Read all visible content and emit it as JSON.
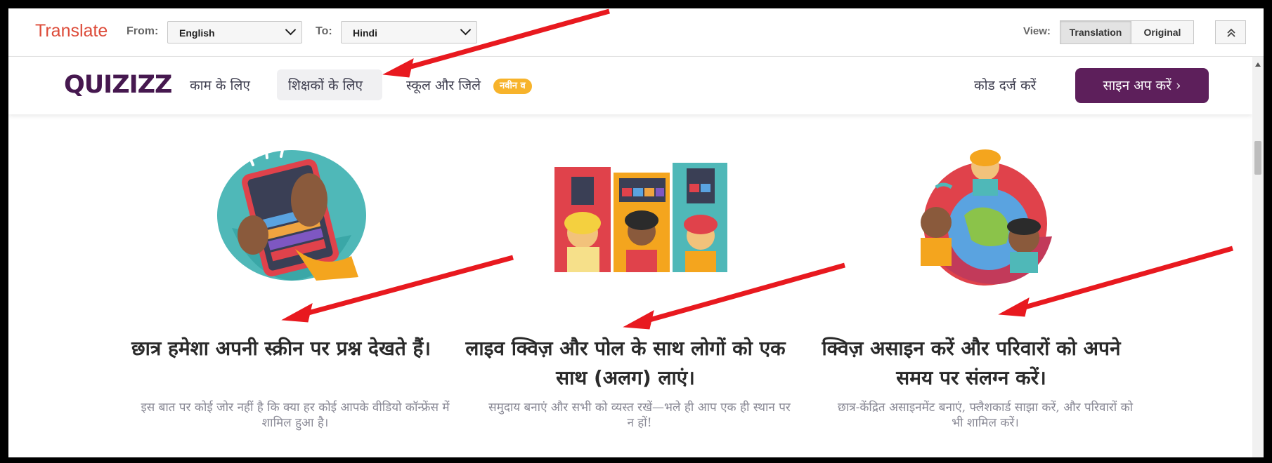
{
  "translate_bar": {
    "brand": "Translate",
    "from_label": "From:",
    "from_value": "English",
    "to_label": "To:",
    "to_value": "Hindi",
    "view_label": "View:",
    "view_translation": "Translation",
    "view_original": "Original"
  },
  "nav": {
    "logo": "QUIZIZZ",
    "items": [
      {
        "label": "काम के लिए"
      },
      {
        "label": "शिक्षकों के लिए"
      },
      {
        "label": "स्कूल और जिले"
      }
    ],
    "badge": "नवीन व",
    "code_link": "कोड दर्ज करें",
    "signup": "साइन अप करें ›"
  },
  "features": [
    {
      "title": "छात्र हमेशा अपनी स्क्रीन पर प्रश्न देखते हैं।",
      "desc": "इस बात पर कोई जोर नहीं है कि क्या हर कोई आपके वीडियो कॉन्फ्रेंस में शामिल हुआ है।"
    },
    {
      "title": "लाइव क्विज़ और पोल के साथ लोगों को एक साथ (अलग) लाएं।",
      "desc": "समुदाय बनाएं और सभी को व्यस्त रखें—भले ही आप एक ही स्थान पर न हों!"
    },
    {
      "title": "क्विज़ असाइन करें और परिवारों को अपने समय पर संलग्न करें।",
      "desc": "छात्र-केंद्रित असाइनमेंट बनाएं, फ्लैशकार्ड साझा करें, और परिवारों को भी शामिल करें।"
    }
  ],
  "colors": {
    "brand_red": "#dd4b39",
    "quizizz_purple": "#5d1f5b",
    "badge_yellow": "#f7b32b",
    "annotation_red": "#e8191f"
  }
}
